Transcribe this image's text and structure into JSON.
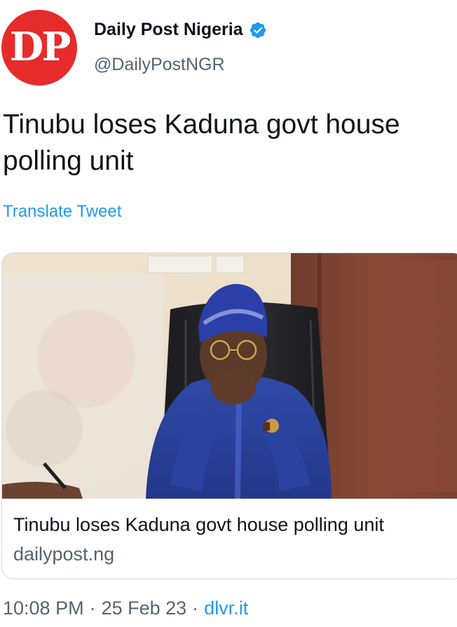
{
  "author": {
    "avatar_initials": "DP",
    "display_name": "Daily Post Nigeria",
    "handle": "@DailyPostNGR",
    "verified": true,
    "avatar_color": "#e62b2b"
  },
  "tweet": {
    "text": "Tinubu loses Kaduna govt house polling unit",
    "translate_label": "Translate Tweet"
  },
  "card": {
    "title": "Tinubu loses Kaduna govt house polling unit",
    "domain": "dailypost.ng"
  },
  "meta": {
    "time": "10:08 PM",
    "separator": "·",
    "date": "25 Feb 23",
    "source": "dlvr.it"
  },
  "colors": {
    "link": "#1d9bf0",
    "secondary_text": "#536471",
    "primary_text": "#0f1419",
    "verified_badge": "#1d9bf0"
  },
  "icons": {
    "verified": "verified-badge-icon"
  }
}
